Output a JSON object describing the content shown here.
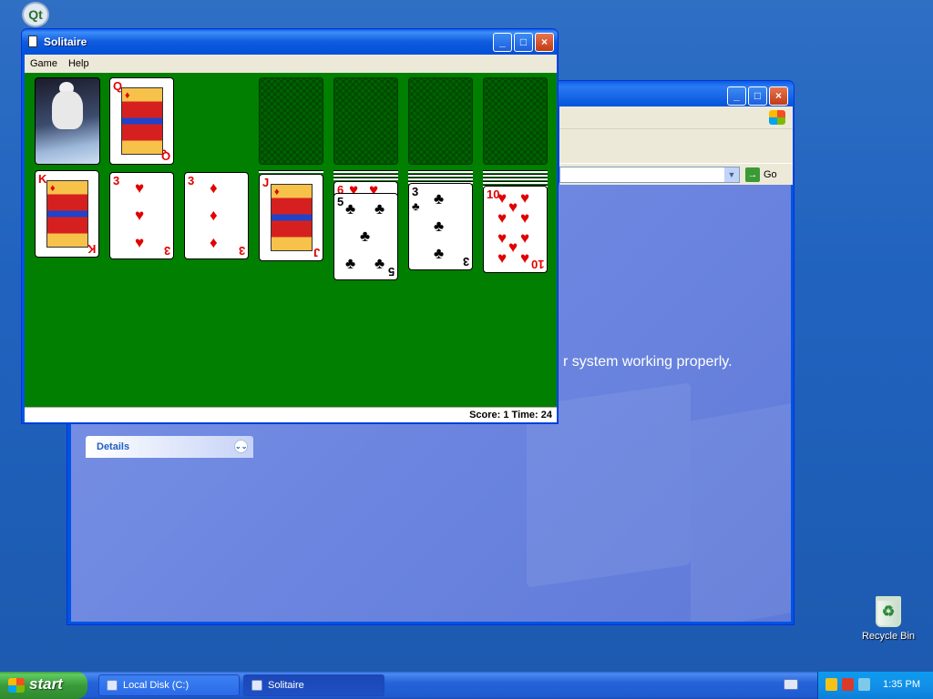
{
  "desktop": {
    "qt_icon_label": "Qt",
    "recycle_bin_label": "Recycle Bin"
  },
  "background_window": {
    "go_label": "Go",
    "message": "r system working properly.",
    "details_label": "Details",
    "chevron_icon": "chevron-down-icon"
  },
  "solitaire": {
    "title": "Solitaire",
    "menu": [
      "Game",
      "Help"
    ],
    "status": "Score: 1 Time: 24",
    "waste_card": {
      "rank": "Q",
      "suit": "♦"
    },
    "tableau": [
      {
        "rank": "K",
        "suit": "♦",
        "face_down": 0
      },
      {
        "rank": "3",
        "suit": "♥",
        "face_down": 0
      },
      {
        "rank": "3",
        "suit": "♦",
        "face_down": 0
      },
      {
        "rank": "J",
        "suit": "♦",
        "face_down": 1
      },
      {
        "rank": "5",
        "suit": "♣",
        "face_down": 3,
        "under": {
          "rank": "6",
          "suit": "♥"
        }
      },
      {
        "rank": "3",
        "suit": "♣",
        "face_down": 4
      },
      {
        "rank": "10",
        "suit": "♥",
        "face_down": 5
      }
    ],
    "colors": {
      "felt": "#007f00",
      "red_suit": "#e00000",
      "black_suit": "#000000"
    }
  },
  "taskbar": {
    "start_label": "start",
    "items": [
      "Local Disk (C:)",
      "Solitaire"
    ],
    "clock": "1:35 PM"
  }
}
